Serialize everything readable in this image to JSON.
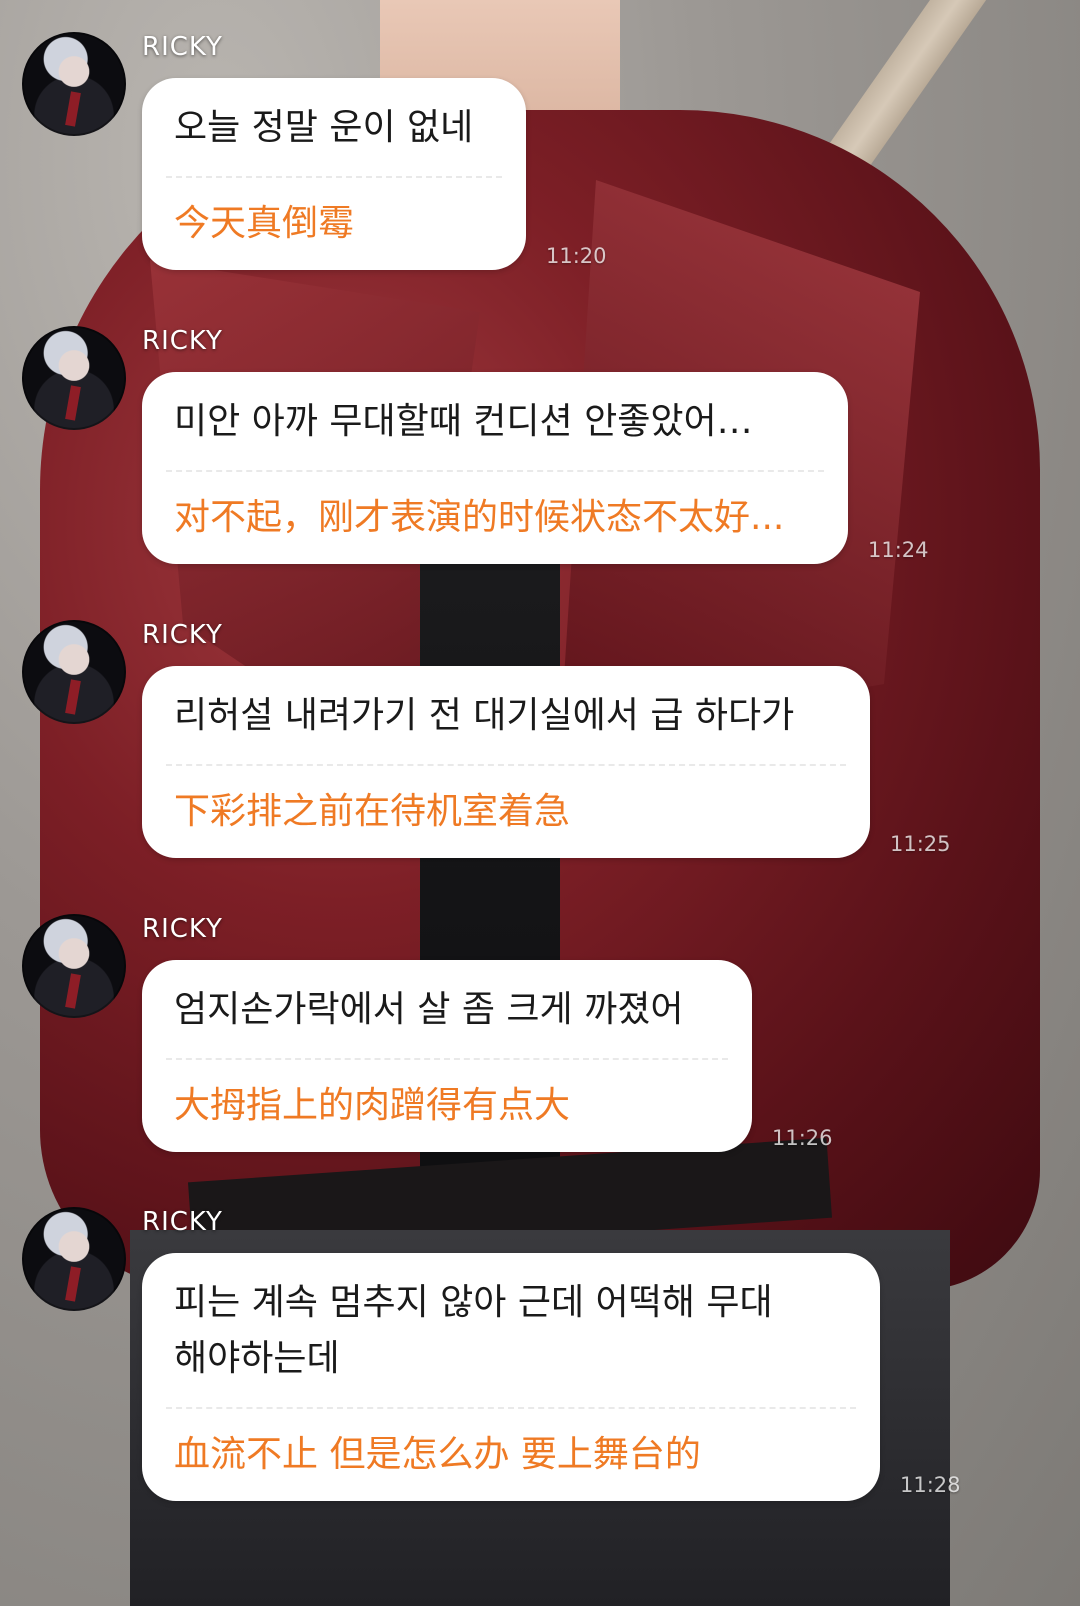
{
  "messages": [
    {
      "sender": "RICKY",
      "original": "오늘 정말 운이 없네",
      "translation": "今天真倒霉",
      "time": "11:20"
    },
    {
      "sender": "RICKY",
      "original": "미안 아까 무대할때 컨디션 안좋았어…",
      "translation": "对不起，刚才表演的时候状态不太好...",
      "time": "11:24"
    },
    {
      "sender": "RICKY",
      "original": "리허설 내려가기 전 대기실에서 급 하다가",
      "translation": "下彩排之前在待机室着急",
      "time": "11:25"
    },
    {
      "sender": "RICKY",
      "original": "엄지손가락에서 살 좀 크게 까졌어",
      "translation": "大拇指上的肉蹭得有点大",
      "time": "11:26"
    },
    {
      "sender": "RICKY",
      "original_line1": "피는 계속 멈추지 않아 근데 어떡해 무대",
      "original_line2": "해야하는데",
      "translation": "血流不止 但是怎么办 要上舞台的",
      "time": "11:28"
    }
  ]
}
